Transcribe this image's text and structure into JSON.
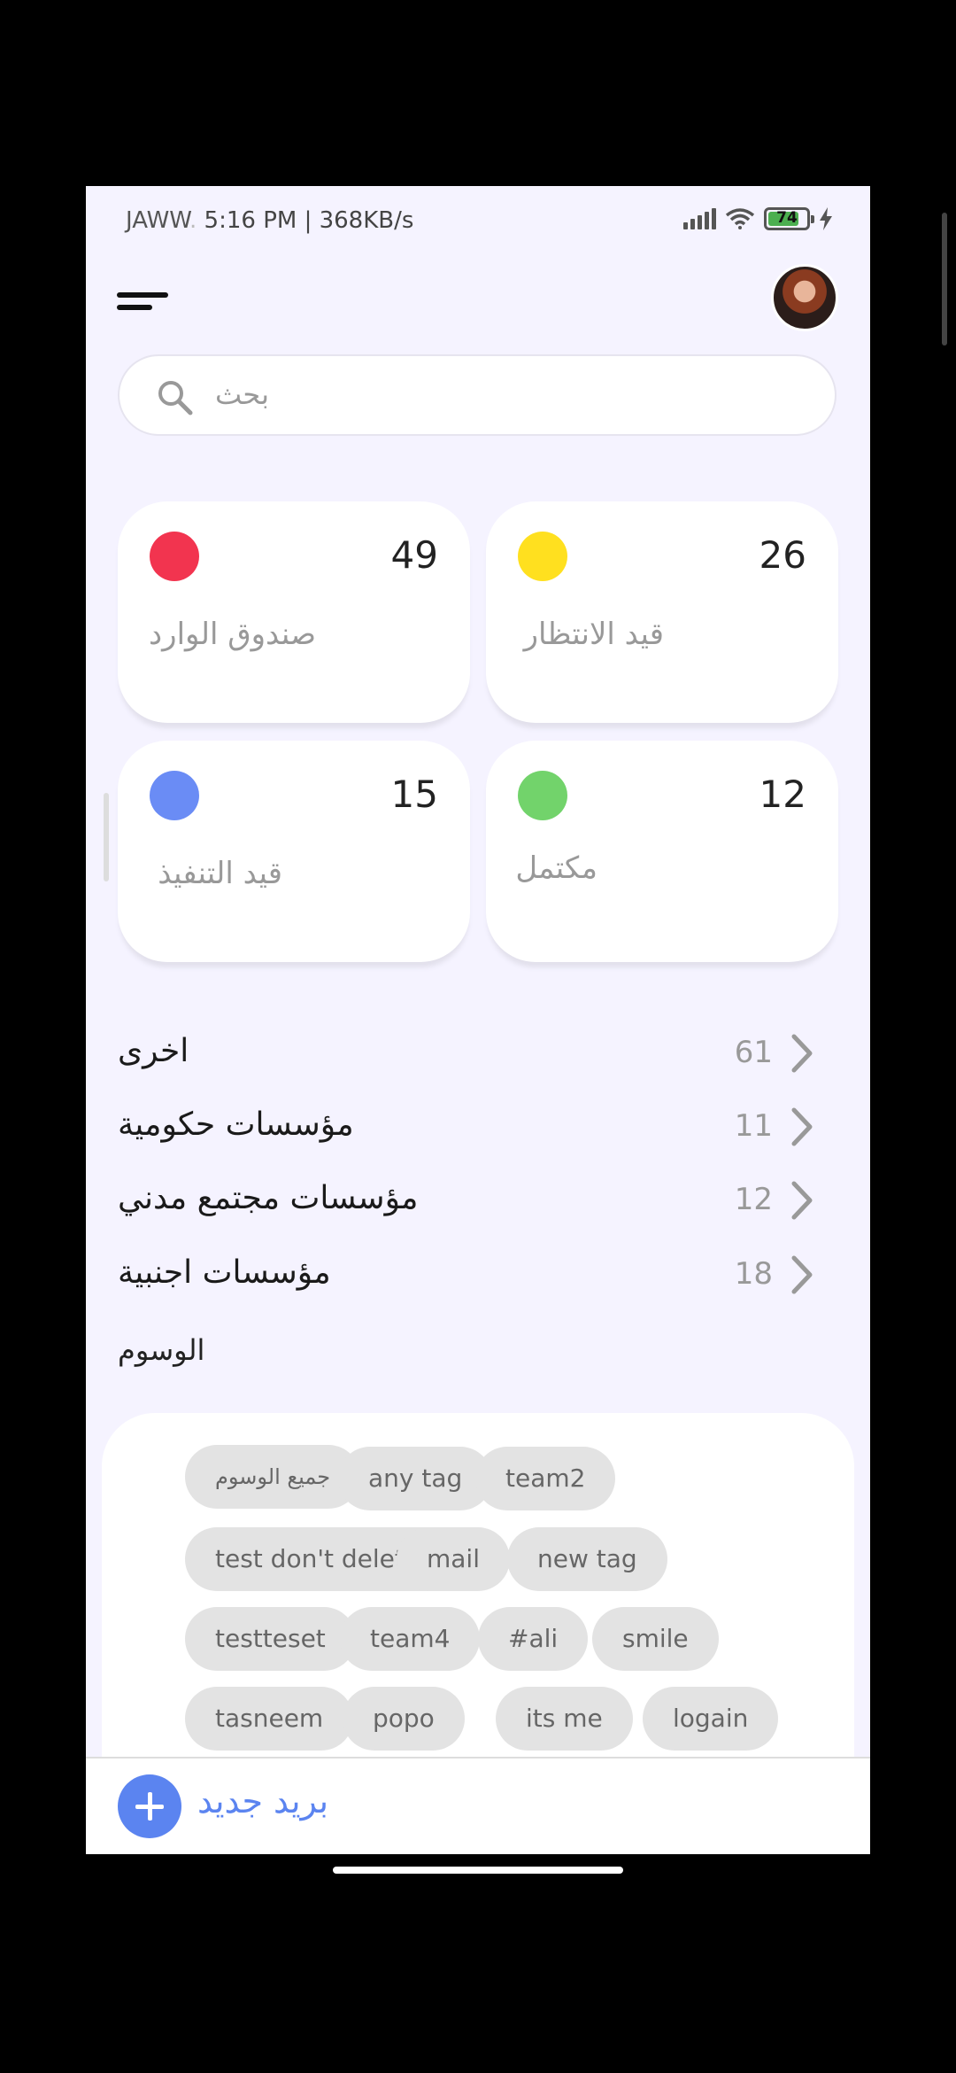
{
  "status_bar": {
    "carrier": "JAWW",
    "carrier_fade": ".",
    "time_speed": "5:16 PM | 368KB/s",
    "battery": "74",
    "battery_level_pct": 74
  },
  "search": {
    "placeholder": "بحث"
  },
  "stats": [
    {
      "count": "49",
      "label": "صندوق الوارد",
      "color": "#f2344f"
    },
    {
      "count": "26",
      "label": "قيد الانتظار",
      "color": "#ffe01f"
    },
    {
      "count": "15",
      "label": "قيد التنفيذ",
      "color": "#6a8cf5"
    },
    {
      "count": "12",
      "label": "مكتمل",
      "color": "#72d36b"
    }
  ],
  "categories": [
    {
      "name": "اخرى",
      "count": "61"
    },
    {
      "name": "مؤسسات حكومية",
      "count": "11"
    },
    {
      "name": "مؤسسات مجتمع مدني",
      "count": "12"
    },
    {
      "name": "مؤسسات اجنبية",
      "count": "18"
    }
  ],
  "tags_title": "الوسوم",
  "tags": [
    "جميع الوسوم",
    "any tag",
    "team2",
    "test don't delete it",
    "mail",
    "new tag",
    "testteset",
    "team4",
    "#ali",
    "smile",
    "tasneem",
    "popo",
    "its me",
    "logain"
  ],
  "bottom": {
    "new_mail": "بريد جديد"
  },
  "colors": {
    "accent": "#5b84f0",
    "background": "#f5f3ff"
  }
}
